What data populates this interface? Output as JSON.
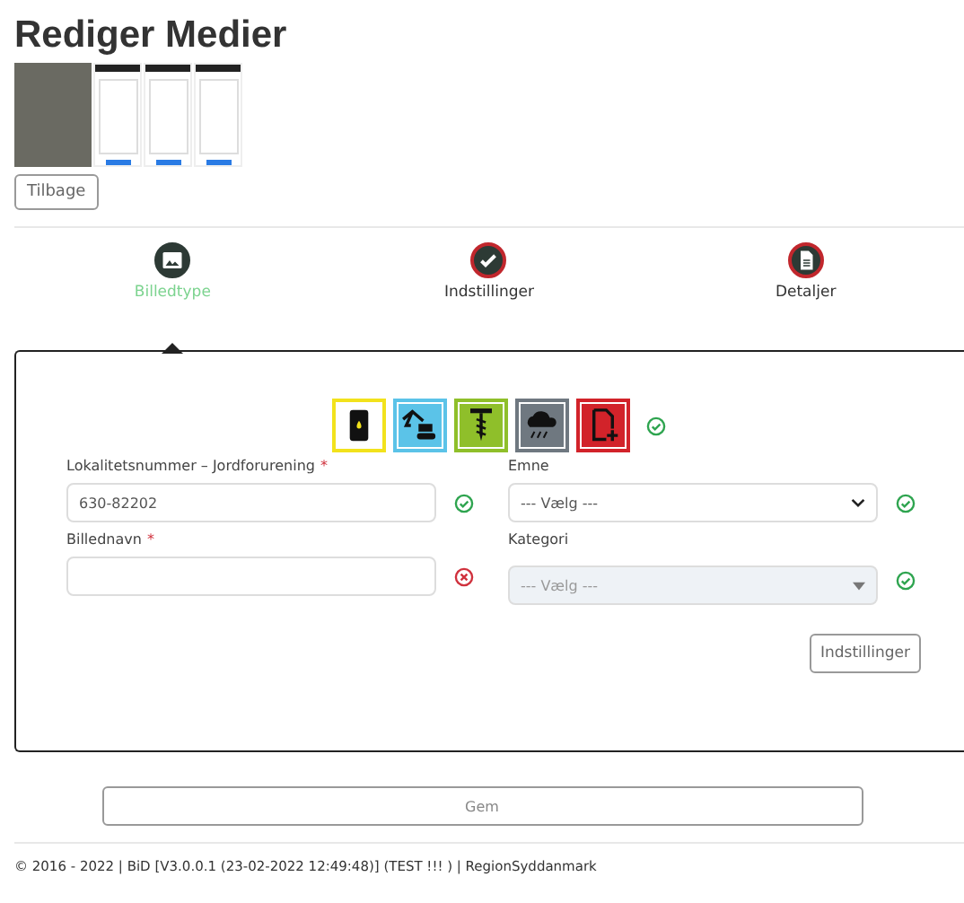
{
  "page_title": "Rediger Medier",
  "media": [
    {
      "kind": "photo"
    },
    {
      "kind": "screenshot"
    },
    {
      "kind": "screenshot"
    },
    {
      "kind": "screenshot"
    }
  ],
  "back_button": "Tilbage",
  "steps": [
    {
      "label": "Billedtype",
      "selected": true
    },
    {
      "label": "Indstillinger",
      "selected": false
    },
    {
      "label": "Detaljer",
      "selected": false
    }
  ],
  "image_types": [
    {
      "color": "#f2e21c",
      "selected": true
    },
    {
      "color": "#5bc3e8",
      "selected": false
    },
    {
      "color": "#8fbf2a",
      "selected": false
    },
    {
      "color": "#6f7880",
      "selected": false
    },
    {
      "color": "#d2232a",
      "selected": false
    }
  ],
  "image_types_valid": true,
  "fields": [
    {
      "kind": "input",
      "label": "Lokalitetsnummer – Jordforurening",
      "required_mark": "*",
      "value": "630-82202",
      "valid": true
    },
    {
      "kind": "select",
      "label": "Emne",
      "value": "--- Vælg ---",
      "valid": true,
      "disabled": false
    },
    {
      "kind": "input",
      "label": "Billednavn",
      "required_mark": "*",
      "valid": false
    },
    {
      "kind": "select",
      "label": "Kategori",
      "value": "--- Vælg ---",
      "valid": true,
      "disabled": true
    }
  ],
  "next_button": "Indstillinger",
  "save_button": "Gem",
  "footer": "© 2016 - 2022 | BiD [V3.0.0.1 (23-02-2022 12:49:48)] (TEST !!! ) | RegionSyddanmark"
}
